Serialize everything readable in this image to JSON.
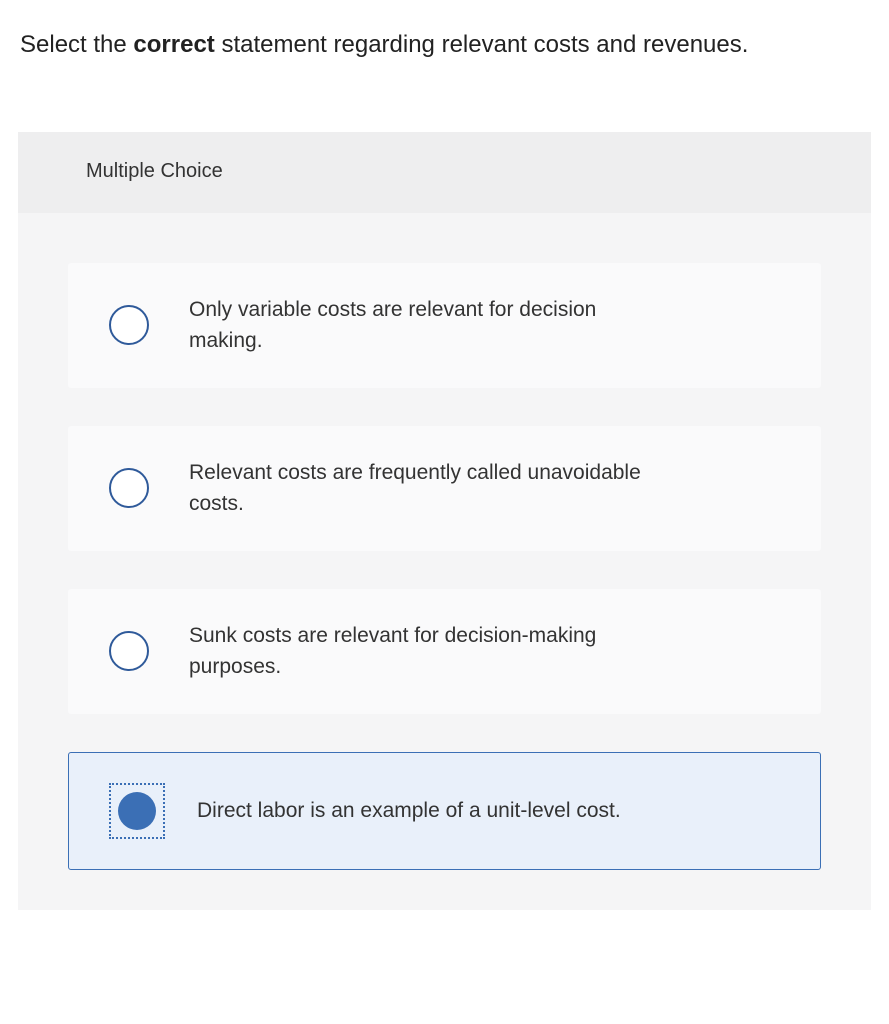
{
  "question": {
    "prefix": "Select the ",
    "bold": "correct",
    "suffix": " statement regarding relevant costs and revenues."
  },
  "section_label": "Multiple Choice",
  "options": [
    {
      "text": "Only variable costs are relevant for decision making.",
      "selected": false
    },
    {
      "text": "Relevant costs are frequently called unavoidable costs.",
      "selected": false
    },
    {
      "text": "Sunk costs are relevant for decision-making purposes.",
      "selected": false
    },
    {
      "text": "Direct labor is an example of a unit-level cost.",
      "selected": true
    }
  ]
}
